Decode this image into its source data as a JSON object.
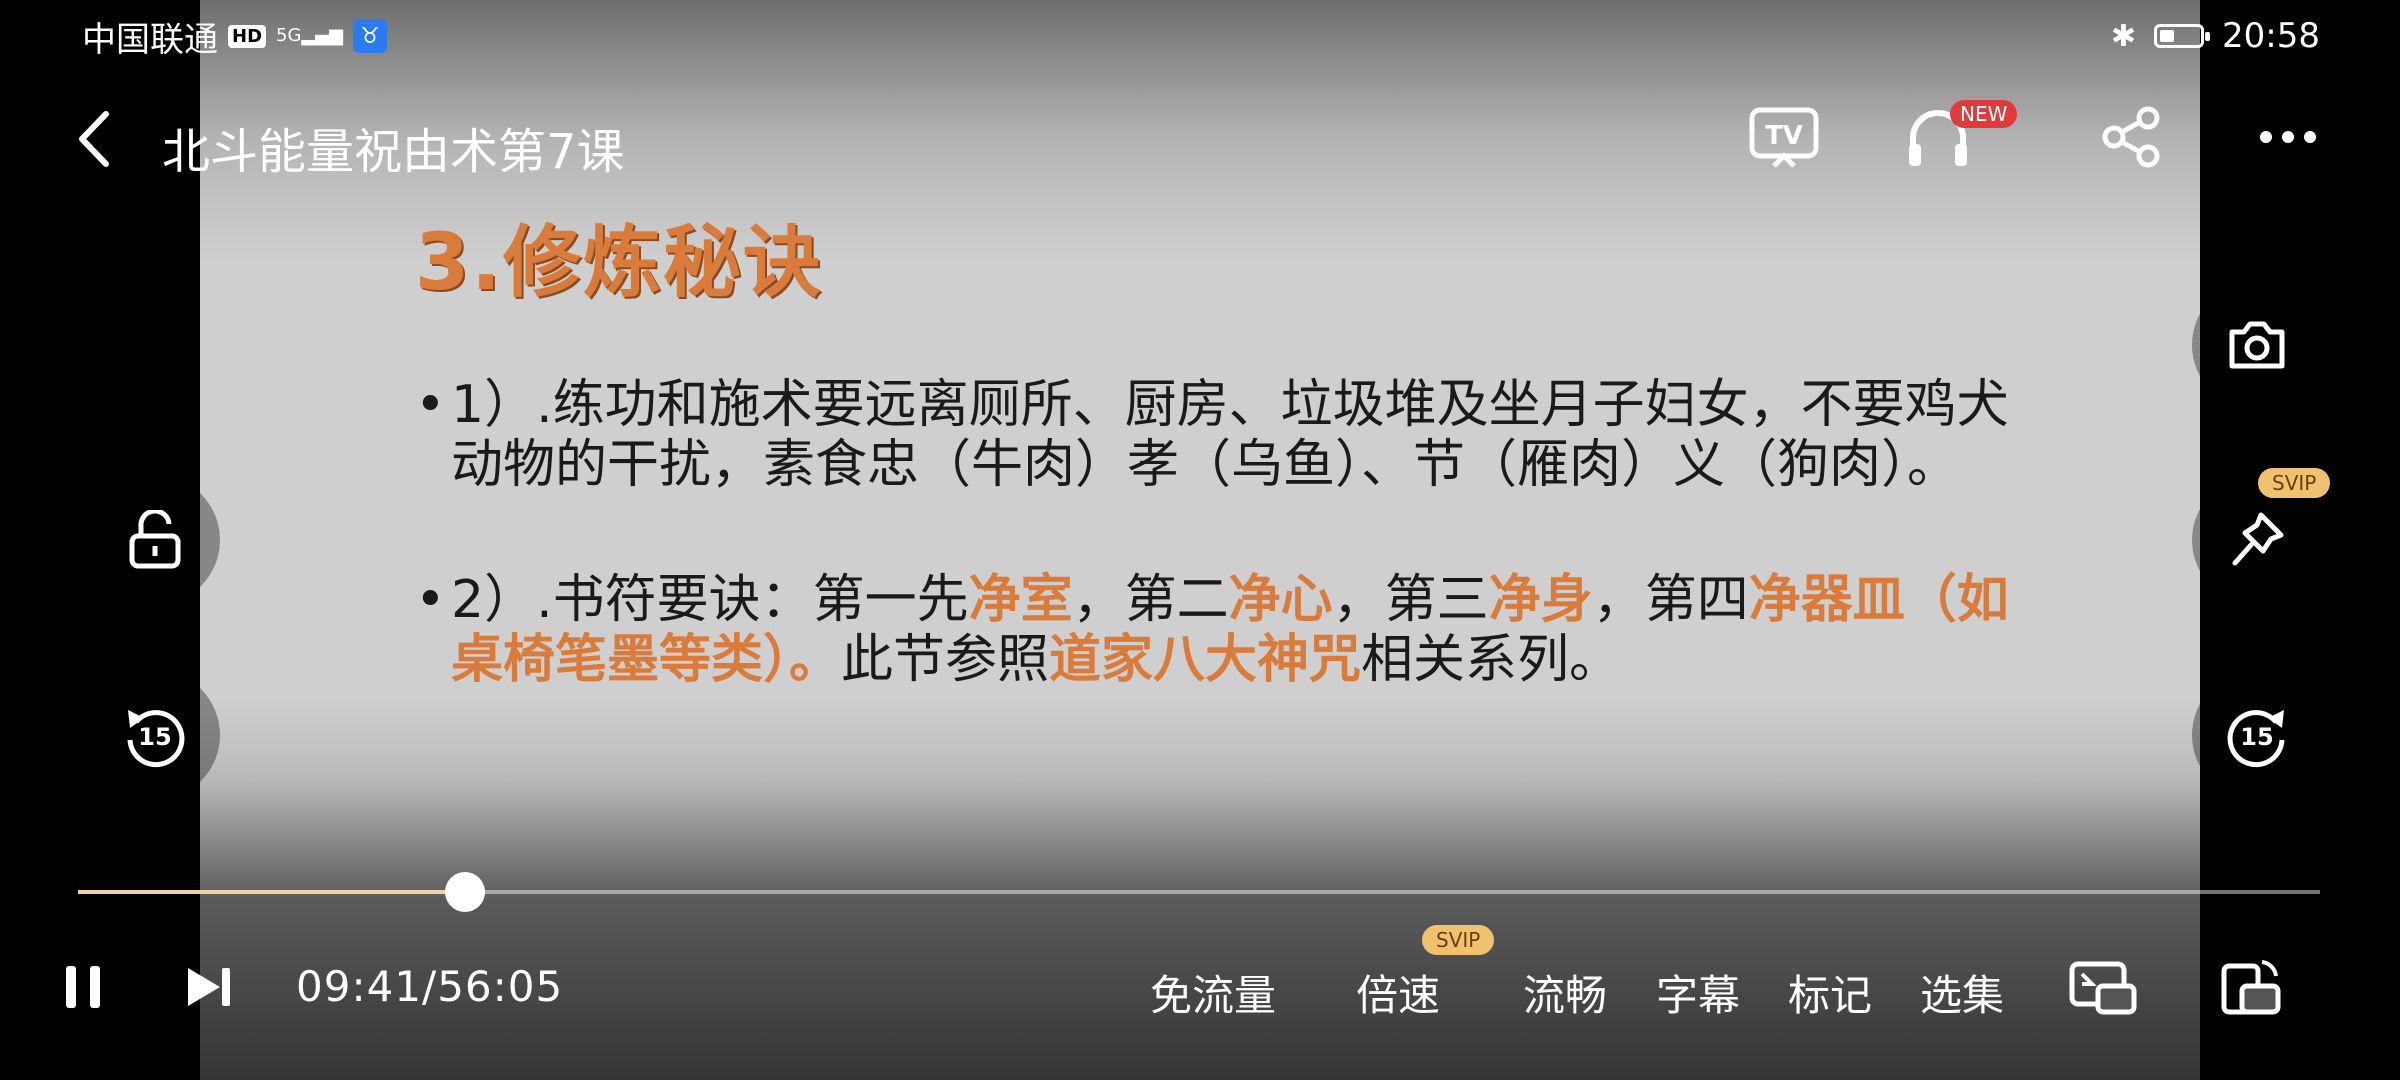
{
  "status_bar": {
    "carrier": "中国联通",
    "hd": "HD",
    "network": "5G",
    "time": "20:58"
  },
  "top_bar": {
    "title": "北斗能量祝由术第7课",
    "new_badge": "NEW"
  },
  "slide": {
    "title": "3.修炼秘诀",
    "bullet1": "1）.练功和施术要远离厕所、厨房、垃圾堆及坐月子妇女，不要鸡犬动物的干扰，素食忠（牛肉）孝（乌鱼）、节（雁肉）义（狗肉）。",
    "bullet2": {
      "p1": "2）.书符要诀：第一先",
      "h1": "净室",
      "p2": "，第二",
      "h2": "净心",
      "p3": "，第三",
      "h3": "净身",
      "p4": "，第四",
      "h4": "净器皿（如桌椅笔墨等类）。",
      "p5": "此节参照",
      "h5": "道家八大神咒",
      "p6": "相关系列。"
    }
  },
  "side": {
    "svip_badge": "SVIP",
    "rewind_seconds": "15",
    "forward_seconds": "15"
  },
  "playback": {
    "current_time": "09:41",
    "total_time": "56:05",
    "time_display": "09:41/56:05",
    "progress_fraction": 0.1726
  },
  "controls": {
    "data_saver": "免流量",
    "speed": "倍速",
    "speed_badge": "SVIP",
    "quality": "流畅",
    "subtitles": "字幕",
    "bookmark": "标记",
    "episodes": "选集"
  },
  "colors": {
    "accent_orange": "#d97b3a",
    "progress_fill": "#f0d3a0",
    "svip_gold": "#f0c270",
    "new_red": "#e03a3a"
  }
}
